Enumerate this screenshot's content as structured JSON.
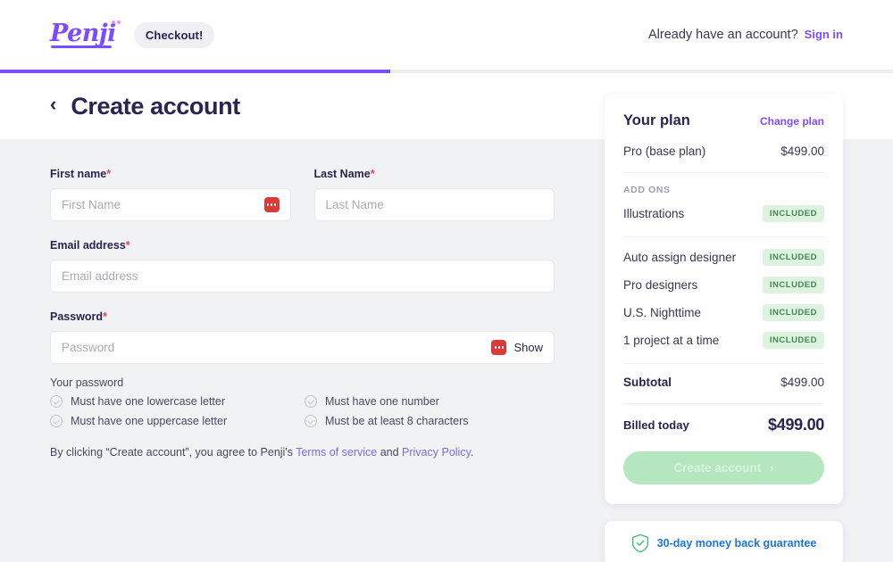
{
  "header": {
    "logo_text": "Penji",
    "logo_icon": "penji-logo",
    "badge_label": "Checkout!",
    "account_prompt": "Already have an account?",
    "signin_label": "Sign in"
  },
  "progress": {
    "percent": 43.7
  },
  "title_bar": {
    "back_icon": "chevron-left-icon",
    "title": "Create account"
  },
  "form": {
    "first_name": {
      "label": "First name",
      "required_mark": "*",
      "placeholder": "First Name",
      "value": "",
      "icon": "lastpass-icon"
    },
    "last_name": {
      "label": "Last Name",
      "required_mark": "*",
      "placeholder": "Last Name",
      "value": ""
    },
    "email": {
      "label": "Email address",
      "required_mark": "*",
      "placeholder": "Email address",
      "value": ""
    },
    "password": {
      "label": "Password",
      "required_mark": "*",
      "placeholder": "Password",
      "value": "",
      "show_label": "Show",
      "icon": "lastpass-icon"
    },
    "hints_title": "Your password",
    "hints": [
      "Must have one lowercase letter",
      "Must have one number",
      "Must have one uppercase letter",
      "Must be at least 8 characters"
    ],
    "terms": {
      "prefix": "By clicking “Create account”, you agree to Penji's ",
      "link1": "Terms of service",
      "middle": " and ",
      "link2": "Privacy Policy",
      "suffix": "."
    }
  },
  "plan": {
    "heading": "Your plan",
    "change_link": "Change plan",
    "base": {
      "name": "Pro (base plan)",
      "price": "$499.00"
    },
    "addons_label": "ADD ONS",
    "addons_primary": [
      {
        "name": "Illustrations",
        "badge": "INCLUDED"
      }
    ],
    "addons_secondary": [
      {
        "name": "Auto assign designer",
        "badge": "INCLUDED"
      },
      {
        "name": "Pro designers",
        "badge": "INCLUDED"
      },
      {
        "name": "U.S. Nighttime",
        "badge": "INCLUDED"
      },
      {
        "name": "1 project at a time",
        "badge": "INCLUDED"
      }
    ],
    "subtotal": {
      "label": "Subtotal",
      "value": "$499.00"
    },
    "billed_today": {
      "label": "Billed today",
      "value": "$499.00"
    },
    "cta_label": "Create account",
    "cta_arrow": "›"
  },
  "guarantee": {
    "icon": "shield-check-icon",
    "text": "30-day money back guarantee"
  },
  "colors": {
    "brand_purple": "#7c4dff",
    "ink": "#2b2350",
    "page_bg": "#f1f2f4",
    "required_red": "#e8435a",
    "badge_green_bg": "#ddf3e0",
    "badge_green_text": "#3f8a52",
    "cta_green": "#b4e6bf",
    "guarantee_blue": "#1c74e0",
    "lastpass_red": "#d83b38"
  }
}
